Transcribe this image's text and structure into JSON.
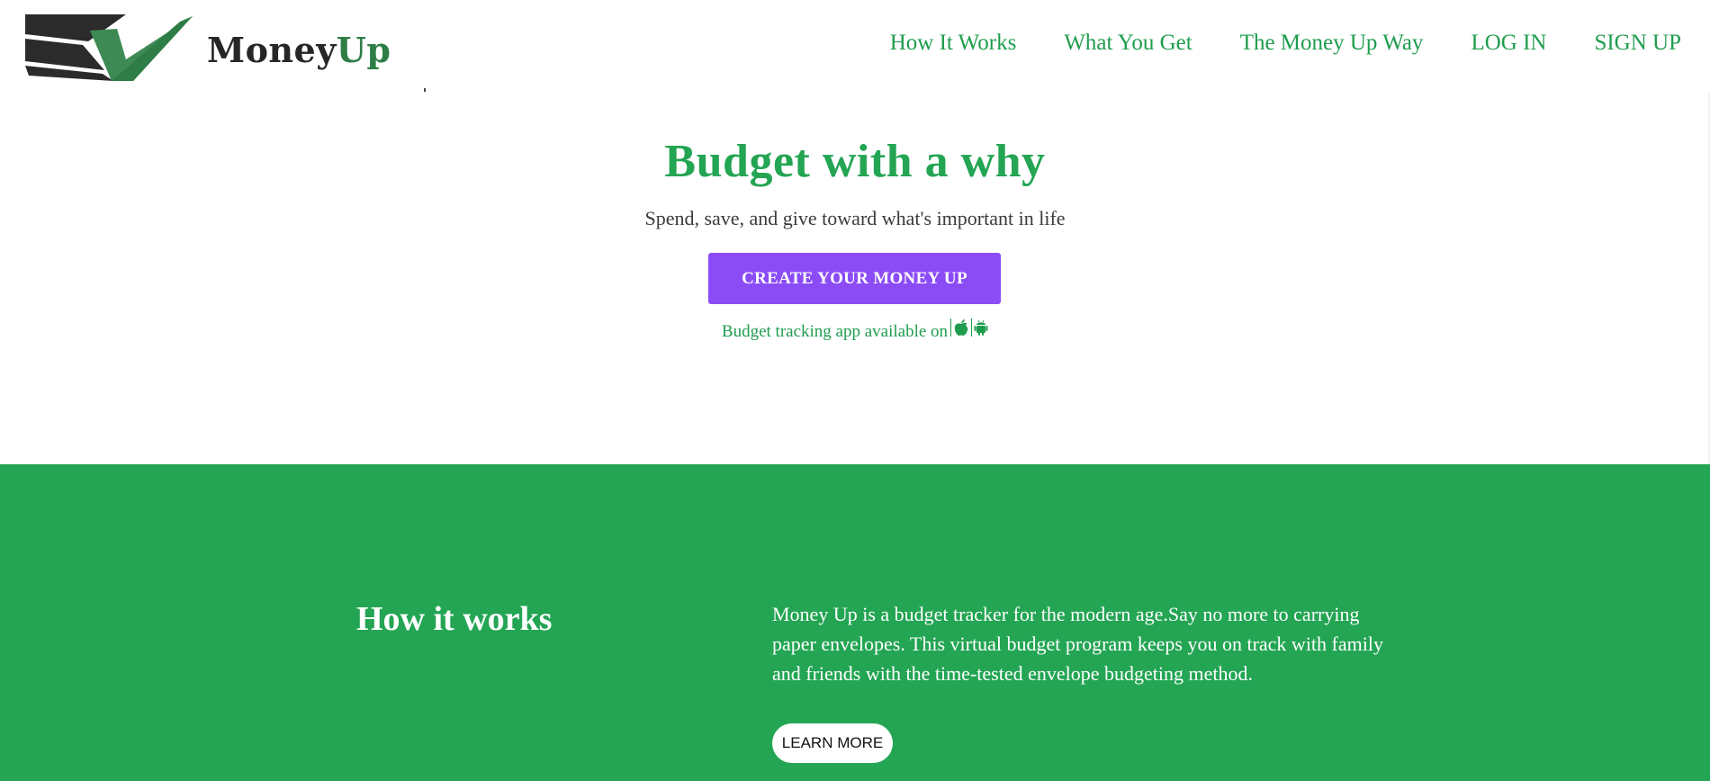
{
  "brand": {
    "name_part1": "Money",
    "name_part2": "Up",
    "colors": {
      "dark": "#262626",
      "green": "#2f7d46"
    }
  },
  "nav": {
    "items": [
      {
        "label": "How It Works"
      },
      {
        "label": "What You Get"
      },
      {
        "label": "The Money Up Way"
      },
      {
        "label": "LOG IN"
      },
      {
        "label": "SIGN UP"
      }
    ],
    "color": "#1f9d4e"
  },
  "hero": {
    "title": "Budget with a why",
    "subtitle": "Spend, save, and give toward what's important in life",
    "cta_label": "CREATE YOUR MONEY UP",
    "availability_text": "Budget tracking app available on",
    "store_icons": [
      "apple-icon",
      "android-icon"
    ],
    "colors": {
      "title": "#23a553",
      "cta": "#8b4cf6"
    }
  },
  "how_it_works": {
    "title": "How it works",
    "body": "Money Up is a budget tracker for the modern age.Say no more to carrying paper envelopes. This virtual budget program keeps you on track with family and friends with the time-tested envelope budgeting method.",
    "button_label": "LEARN MORE",
    "background": "#23a553"
  }
}
